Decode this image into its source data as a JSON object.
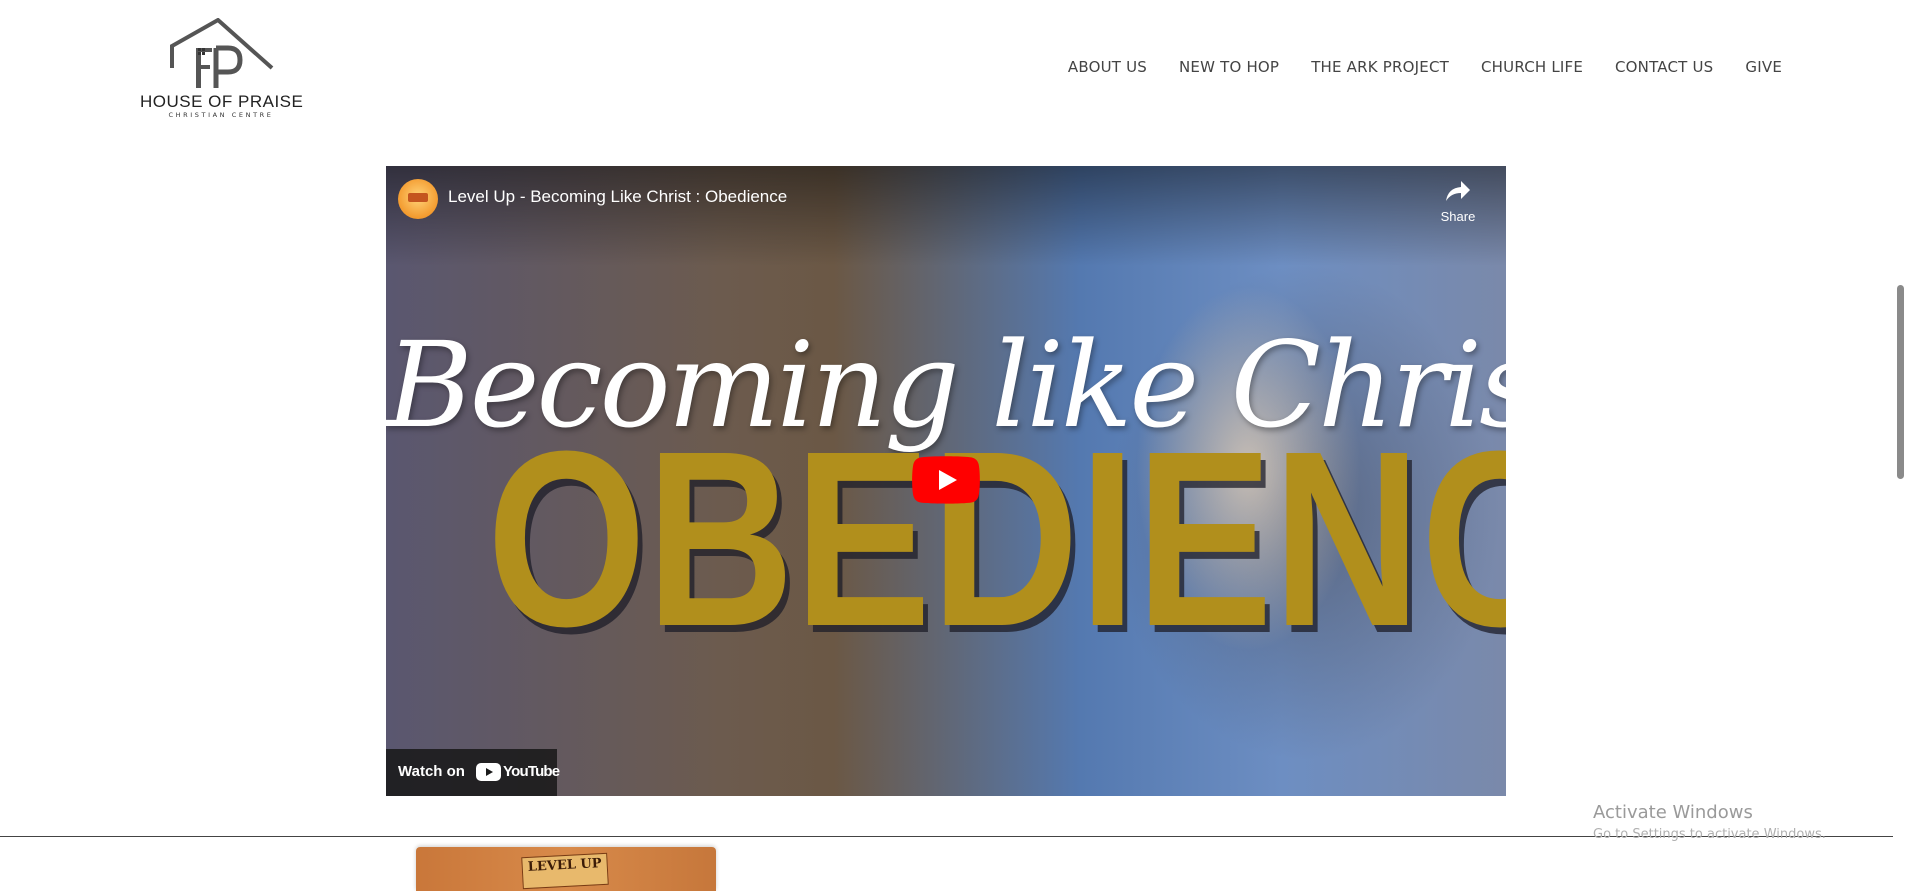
{
  "brand": {
    "name": "HOUSE OF PRAISE",
    "tagline": "CHRISTIAN CENTRE"
  },
  "nav": {
    "items": [
      {
        "label": "ABOUT US"
      },
      {
        "label": "NEW TO HOP"
      },
      {
        "label": "THE ARK PROJECT"
      },
      {
        "label": "CHURCH LIFE"
      },
      {
        "label": "CONTACT US"
      },
      {
        "label": "GIVE"
      }
    ]
  },
  "video": {
    "title": "Level Up - Becoming Like Christ : Obedience",
    "share_label": "Share",
    "thumbnail_script_text": "Becoming like Christ:",
    "thumbnail_big_text": "OBEDIENCE",
    "watch_on_label": "Watch on",
    "platform_name": "YouTube"
  },
  "next_card": {
    "logo_text": "LEVEL UP"
  },
  "os_overlay": {
    "line1": "Activate Windows",
    "line2": "Go to Settings to activate Windows."
  },
  "icons": {
    "logo": "house-roof-logo-icon",
    "share": "share-arrow-icon",
    "play": "youtube-play-icon",
    "youtube": "youtube-logo-icon",
    "avatar": "channel-avatar-icon"
  },
  "colors": {
    "accent_gold": "#b18f1c",
    "youtube_red": "#ff0000",
    "nav_text": "#444444"
  }
}
